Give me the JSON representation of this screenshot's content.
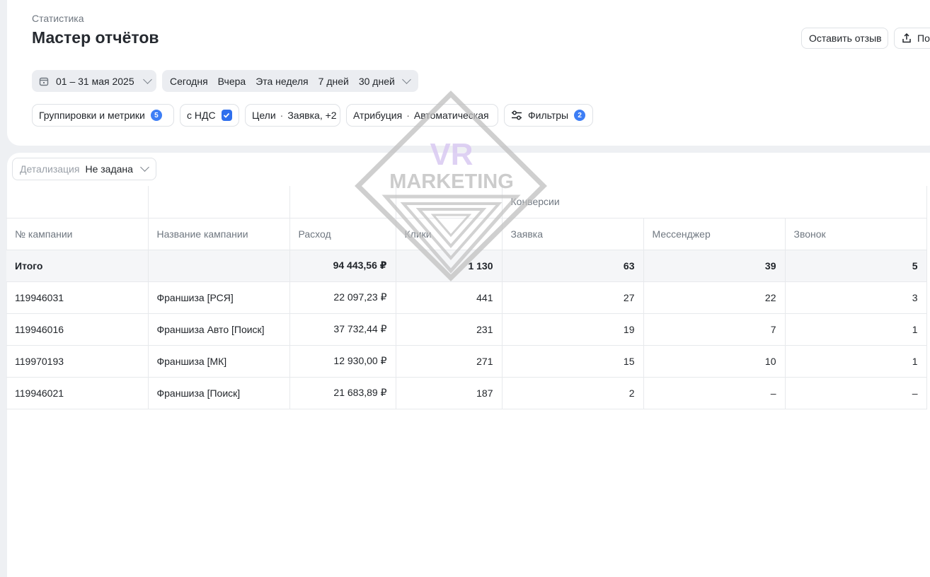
{
  "header": {
    "breadcrumb": "Статистика",
    "title": "Мастер отчётов",
    "feedback_label": "Оставить отзыв",
    "export_label": "По"
  },
  "date_picker": {
    "range": "01 – 31 мая 2025",
    "icon": "calendar-icon"
  },
  "periods": [
    "Сегодня",
    "Вчера",
    "Эта неделя",
    "7 дней",
    "30 дней"
  ],
  "chips": {
    "groupings_label": "Группировки и метрики",
    "groupings_count": "5",
    "vat_label": "с НДС",
    "vat_checked": true,
    "goals_label": "Цели",
    "goals_value": "Заявка, +2",
    "attribution_label": "Атрибуция",
    "attribution_value": "Автоматическая",
    "filters_label": "Фильтры",
    "filters_count": "2",
    "separator": "·"
  },
  "detail": {
    "label": "Детализация",
    "value": "Не задана"
  },
  "watermark": {
    "text_top": "VR",
    "text_bottom": "MARKETING"
  },
  "table": {
    "group_header": "Конверсии",
    "columns": [
      "№ кампании",
      "Название кампании",
      "Расход",
      "Клики",
      "Заявка",
      "Мессенджер",
      "Звонок"
    ],
    "total": {
      "label": "Итого",
      "cells": [
        "94 443,56 ₽",
        "1 130",
        "63",
        "39",
        "5"
      ]
    },
    "rows": [
      {
        "id": "119946031",
        "name": "Франшиза [РСЯ]",
        "cost": "22 097,23 ₽",
        "clicks": "441",
        "lead": "27",
        "messenger": "22",
        "call": "3"
      },
      {
        "id": "119946016",
        "name": "Франшиза Авто [Поиск]",
        "cost": "37 732,44 ₽",
        "clicks": "231",
        "lead": "19",
        "messenger": "7",
        "call": "1"
      },
      {
        "id": "119970193",
        "name": "Франшиза [МК]",
        "cost": "12 930,00 ₽",
        "clicks": "271",
        "lead": "15",
        "messenger": "10",
        "call": "1"
      },
      {
        "id": "119946021",
        "name": "Франшиза [Поиск]",
        "cost": "21 683,89 ₽",
        "clicks": "187",
        "lead": "2",
        "messenger": "–",
        "call": "–"
      }
    ]
  },
  "colors": {
    "accent": "#3d7ef5",
    "background": "#eef0f3",
    "total_row": "#f5f6f8"
  }
}
